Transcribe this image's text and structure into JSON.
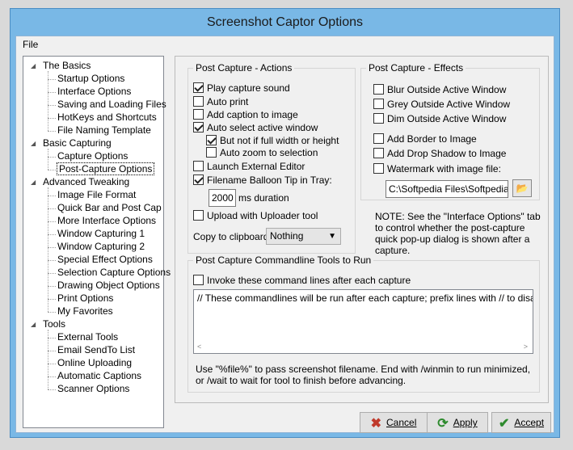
{
  "window": {
    "title": "Screenshot Captor Options"
  },
  "menu": {
    "file": "File"
  },
  "tree": [
    {
      "label": "The Basics",
      "level": 0
    },
    {
      "label": "Startup Options",
      "level": 1
    },
    {
      "label": "Interface Options",
      "level": 1
    },
    {
      "label": "Saving and Loading Files",
      "level": 1
    },
    {
      "label": "HotKeys and Shortcuts",
      "level": 1
    },
    {
      "label": "File Naming Template",
      "level": 1
    },
    {
      "label": "Basic Capturing",
      "level": 0
    },
    {
      "label": "Capture Options",
      "level": 1
    },
    {
      "label": "Post-Capture Options",
      "level": 1,
      "selected": true
    },
    {
      "label": "Advanced Tweaking",
      "level": 0
    },
    {
      "label": "Image File Format",
      "level": 1
    },
    {
      "label": "Quick Bar and Post Cap",
      "level": 1
    },
    {
      "label": "More Interface Options",
      "level": 1
    },
    {
      "label": "Window Capturing 1",
      "level": 1
    },
    {
      "label": "Window Capturing 2",
      "level": 1
    },
    {
      "label": "Special Effect Options",
      "level": 1
    },
    {
      "label": "Selection Capture Options",
      "level": 1
    },
    {
      "label": "Drawing Object Options",
      "level": 1
    },
    {
      "label": "Print Options",
      "level": 1
    },
    {
      "label": "My Favorites",
      "level": 1
    },
    {
      "label": "Tools",
      "level": 0
    },
    {
      "label": "External Tools",
      "level": 1
    },
    {
      "label": "Email SendTo List",
      "level": 1
    },
    {
      "label": "Online Uploading",
      "level": 1
    },
    {
      "label": "Automatic Captions",
      "level": 1
    },
    {
      "label": "Scanner Options",
      "level": 1
    }
  ],
  "actions": {
    "title": "Post Capture - Actions",
    "play_sound": {
      "label": "Play capture sound",
      "checked": true
    },
    "auto_print": {
      "label": "Auto print",
      "checked": false
    },
    "add_caption": {
      "label": "Add caption to image",
      "checked": false
    },
    "auto_select": {
      "label": "Auto select active window",
      "checked": true
    },
    "not_full": {
      "label": "But not if full width or height",
      "checked": true
    },
    "auto_zoom": {
      "label": "Auto zoom to selection",
      "checked": false
    },
    "launch_editor": {
      "label": "Launch External Editor",
      "checked": false
    },
    "balloon_tip": {
      "label": "Filename Balloon Tip in Tray:",
      "checked": true
    },
    "duration_value": "2000",
    "duration_label": "ms duration",
    "upload": {
      "label": "Upload with Uploader tool",
      "checked": false
    },
    "clipboard_label": "Copy to clipboard:",
    "clipboard_value": "Nothing"
  },
  "effects": {
    "title": "Post Capture - Effects",
    "blur": {
      "label": "Blur Outside Active Window",
      "checked": false
    },
    "grey": {
      "label": "Grey Outside Active Window",
      "checked": false
    },
    "dim": {
      "label": "Dim Outside Active Window",
      "checked": false
    },
    "border": {
      "label": "Add Border to Image",
      "checked": false
    },
    "shadow": {
      "label": "Add Drop Shadow to Image",
      "checked": false
    },
    "watermark": {
      "label": "Watermark with image file:",
      "checked": false
    },
    "watermark_path": "C:\\Softpedia Files\\Softpedia.b"
  },
  "note": "NOTE: See the \"Interface Options\" tab to control whether the post-capture quick pop-up dialog is shown after a capture.",
  "commandline": {
    "title": "Post Capture Commandline Tools to Run",
    "invoke": {
      "label": "Invoke these command lines after each capture",
      "checked": false
    },
    "text": "// These commandlines will be run after each capture; prefix lines with // to disable.",
    "help": "Use \"%file%\" to pass screenshot filename. End with /winmin to run minimized, or /wait to wait for tool to finish before advancing."
  },
  "buttons": {
    "cancel": "Cancel",
    "apply": "Apply",
    "accept": "Accept"
  },
  "colors": {
    "cancel_icon": "#c0392b",
    "apply_icon": "#2e8b2e",
    "accept_icon": "#2e8b2e",
    "title_bar": "#79b8e6"
  }
}
